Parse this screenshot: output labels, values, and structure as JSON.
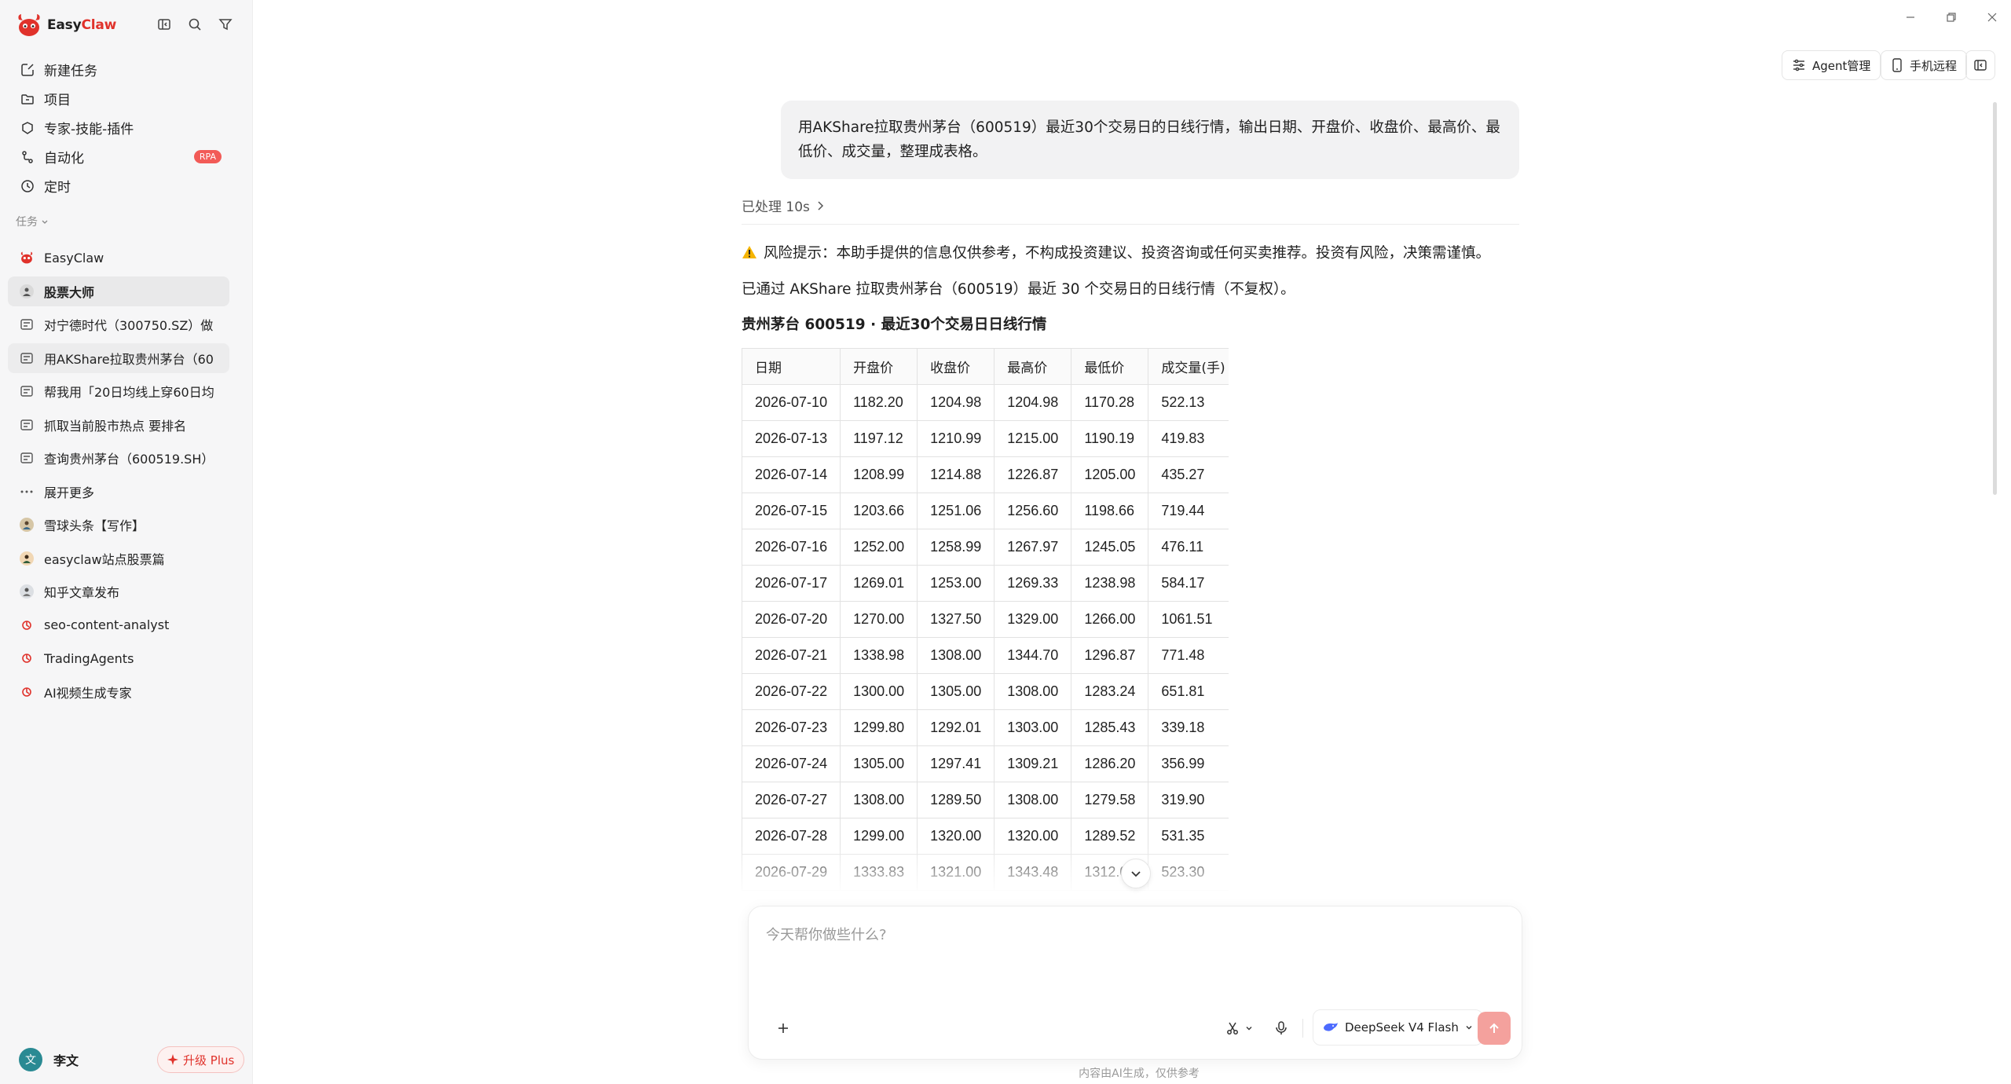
{
  "brand": {
    "name_prefix": "Easy",
    "name_suffix": "Claw"
  },
  "nav": [
    {
      "label": "新建任务",
      "icon": "new-task-icon"
    },
    {
      "label": "项目",
      "icon": "folder-icon"
    },
    {
      "label": "专家-技能-插件",
      "icon": "puzzle-icon"
    },
    {
      "label": "自动化",
      "icon": "automation-icon",
      "badge": "RPA"
    },
    {
      "label": "定时",
      "icon": "clock-icon"
    }
  ],
  "section_label": "任务",
  "tasks": [
    {
      "label": "EasyClaw",
      "icon": "easyclaw-logo-icon"
    },
    {
      "label": "股票大师",
      "icon": "agent-avatar-icon"
    },
    {
      "label": "对宁德时代（300750.SZ）做",
      "icon": "chat-icon"
    },
    {
      "label": "用AKShare拉取贵州茅台（60",
      "icon": "chat-icon"
    },
    {
      "label": "帮我用「20日均线上穿60日均",
      "icon": "chat-icon"
    },
    {
      "label": "抓取当前股市热点 要排名",
      "icon": "chat-icon"
    },
    {
      "label": "查询贵州茅台（600519.SH）",
      "icon": "chat-icon"
    },
    {
      "label": "展开更多",
      "icon": "more-icon"
    },
    {
      "label": "雪球头条【写作】",
      "icon": "agent-avatar-icon"
    },
    {
      "label": "easyclaw站点股票篇",
      "icon": "agent-avatar-icon"
    },
    {
      "label": "知乎文章发布",
      "icon": "agent-avatar-icon"
    },
    {
      "label": "seo-content-analyst",
      "icon": "skill-icon"
    },
    {
      "label": "TradingAgents",
      "icon": "skill-icon"
    },
    {
      "label": "AI视频生成专家",
      "icon": "skill-icon"
    }
  ],
  "user": {
    "avatar_text": "文",
    "name": "李文",
    "upgrade_label": "升级 Plus"
  },
  "topbar": {
    "agent_label": "Agent管理",
    "phone_label": "手机远程"
  },
  "chat": {
    "user_message": "用AKShare拉取贵州茅台（600519）最近30个交易日的日线行情，输出日期、开盘价、收盘价、最高价、最低价、成交量，整理成表格。",
    "processed": "已处理 10s",
    "warning": "风险提示：本助手提供的信息仅供参考，不构成投资建议、投资咨询或任何买卖推荐。投资有风险，决策需谨慎。",
    "info": "已通过 AKShare 拉取贵州茅台（600519）最近 30 个交易日的日线行情（不复权）。",
    "table_title": "贵州茅台 600519 · 最近30个交易日日线行情",
    "table": {
      "headers": [
        "日期",
        "开盘价",
        "收盘价",
        "最高价",
        "最低价",
        "成交量(手)"
      ],
      "rows": [
        [
          "2026-07-10",
          "1182.20",
          "1204.98",
          "1204.98",
          "1170.28",
          "522.13"
        ],
        [
          "2026-07-13",
          "1197.12",
          "1210.99",
          "1215.00",
          "1190.19",
          "419.83"
        ],
        [
          "2026-07-14",
          "1208.99",
          "1214.88",
          "1226.87",
          "1205.00",
          "435.27"
        ],
        [
          "2026-07-15",
          "1203.66",
          "1251.06",
          "1256.60",
          "1198.66",
          "719.44"
        ],
        [
          "2026-07-16",
          "1252.00",
          "1258.99",
          "1267.97",
          "1245.05",
          "476.11"
        ],
        [
          "2026-07-17",
          "1269.01",
          "1253.00",
          "1269.33",
          "1238.98",
          "584.17"
        ],
        [
          "2026-07-20",
          "1270.00",
          "1327.50",
          "1329.00",
          "1266.00",
          "1061.51"
        ],
        [
          "2026-07-21",
          "1338.98",
          "1308.00",
          "1344.70",
          "1296.87",
          "771.48"
        ],
        [
          "2026-07-22",
          "1300.00",
          "1305.00",
          "1308.00",
          "1283.24",
          "651.81"
        ],
        [
          "2026-07-23",
          "1299.80",
          "1292.01",
          "1303.00",
          "1285.43",
          "339.18"
        ],
        [
          "2026-07-24",
          "1305.00",
          "1297.41",
          "1309.21",
          "1286.20",
          "356.99"
        ],
        [
          "2026-07-27",
          "1308.00",
          "1289.50",
          "1308.00",
          "1279.58",
          "319.90"
        ],
        [
          "2026-07-28",
          "1299.00",
          "1320.00",
          "1320.00",
          "1289.52",
          "531.35"
        ],
        [
          "2026-07-29",
          "1333.83",
          "1321.00",
          "1343.48",
          "1312.06",
          "523.30"
        ]
      ]
    }
  },
  "composer": {
    "placeholder": "今天帮你做些什么?",
    "model": "DeepSeek V4 Flash",
    "disclaimer": "内容由AI生成，仅供参考"
  },
  "colors": {
    "accent": "#e0322b",
    "send_disabled": "#f4a19d",
    "rpa_badge": "#f25b57"
  }
}
